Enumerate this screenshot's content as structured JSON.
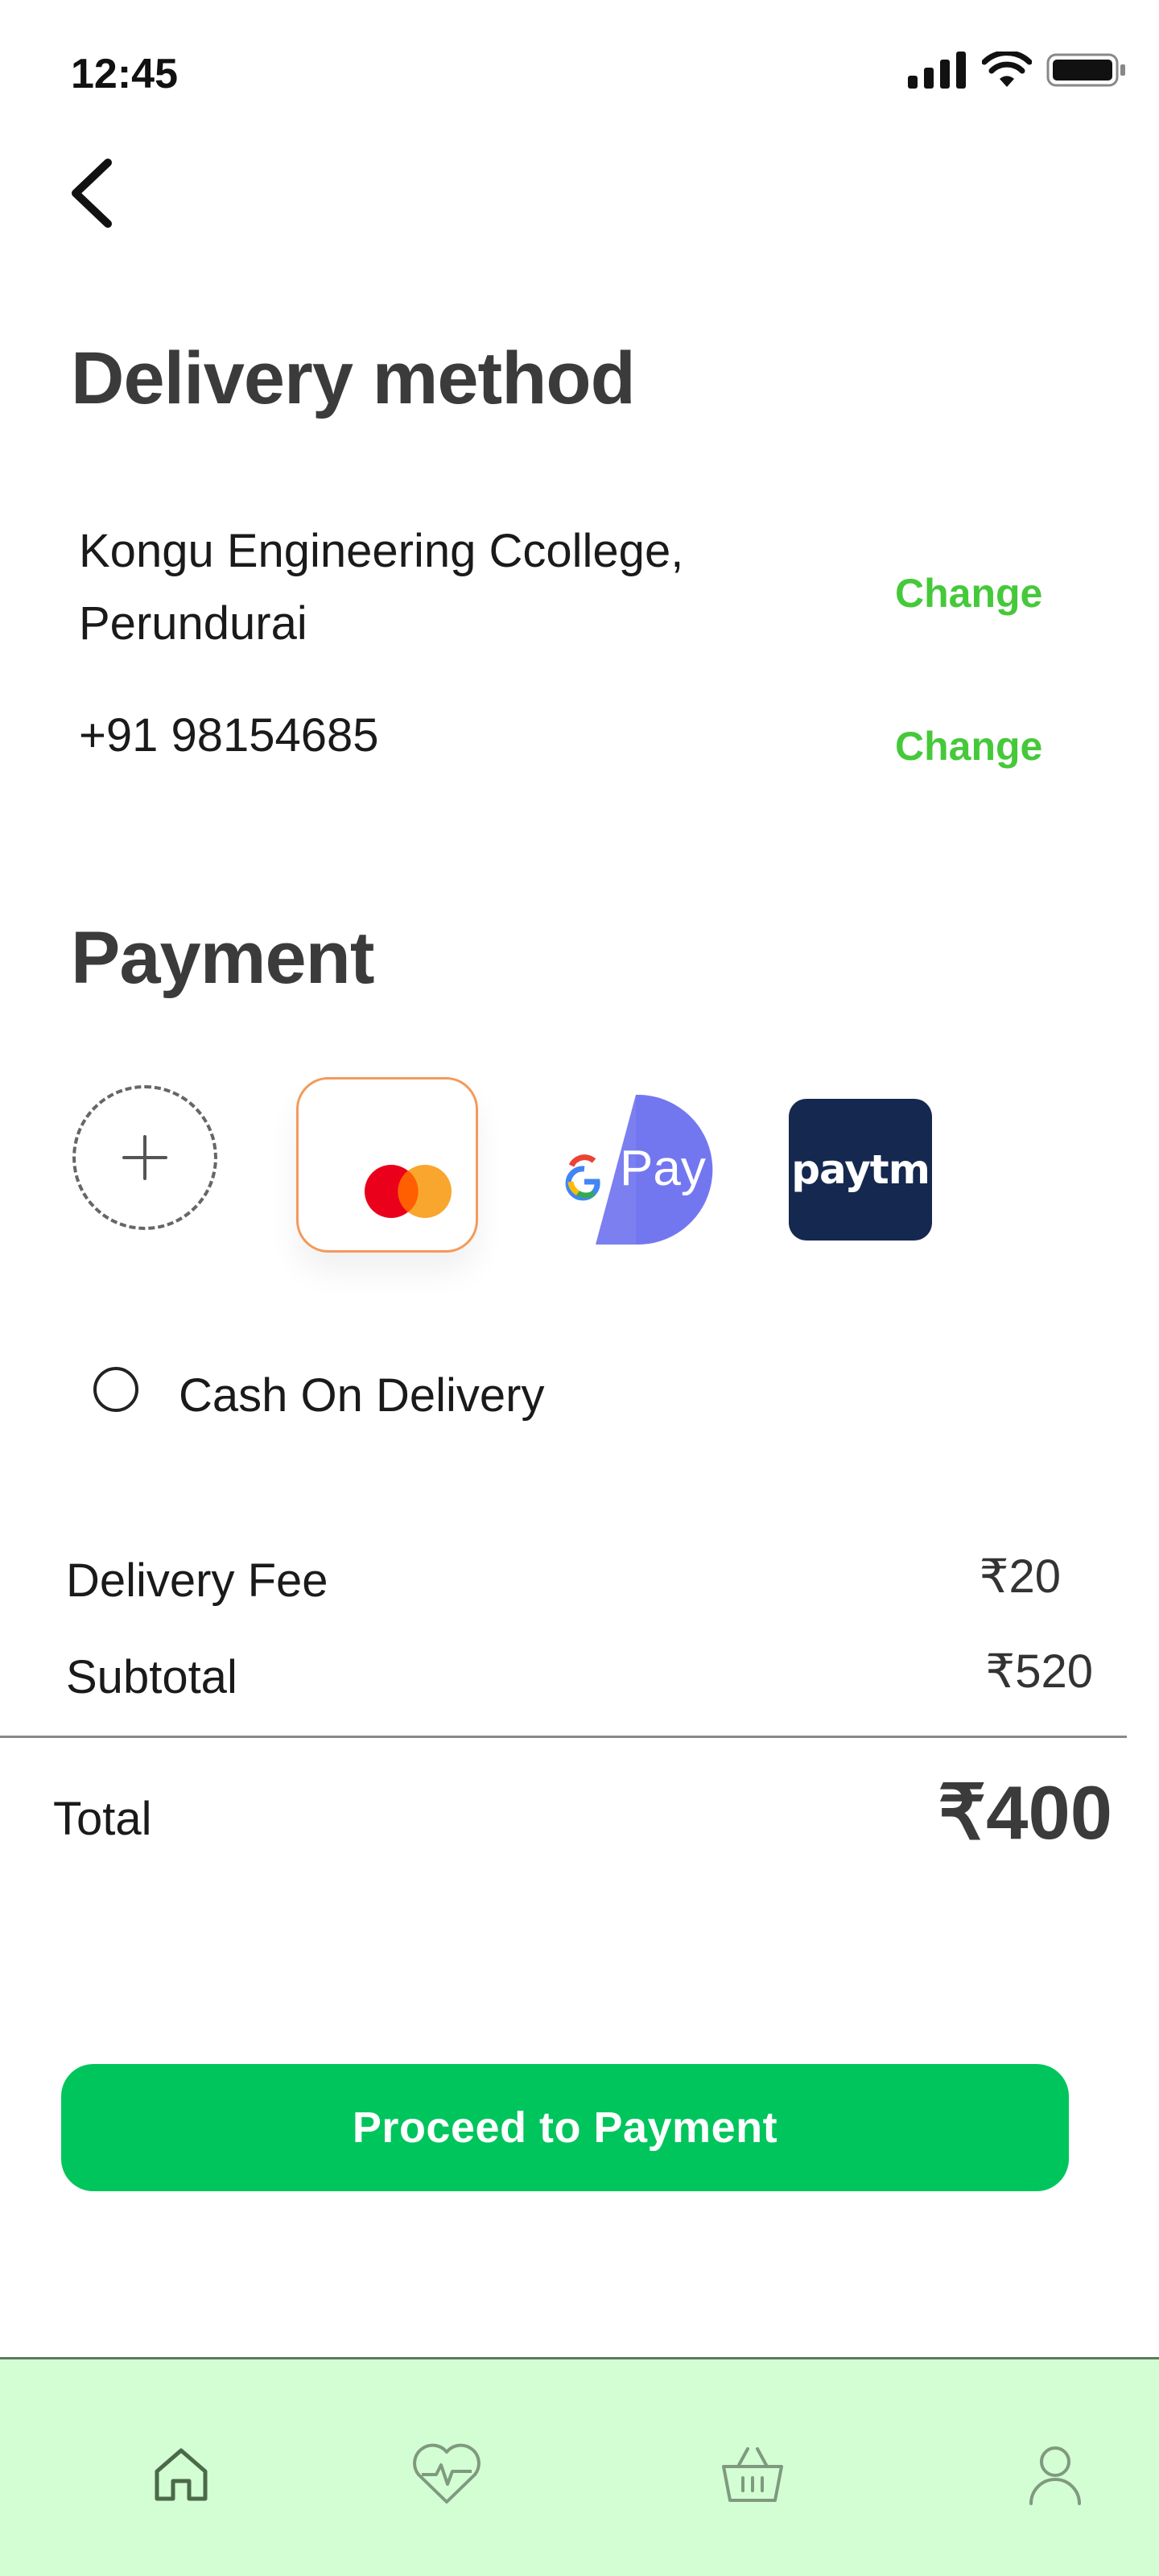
{
  "status_bar": {
    "time": "12:45",
    "icons": [
      "signal-icon",
      "wifi-icon",
      "battery-icon"
    ]
  },
  "header": {
    "back_icon": "chevron-left-icon"
  },
  "delivery": {
    "title": "Delivery method",
    "address_line1": "Kongu Engineering Ccollege,",
    "address_line2": "Perundurai",
    "phone": "+91 98154685",
    "change_address_label": "Change",
    "change_phone_label": "Change",
    "accent_color": "#45c93a"
  },
  "payment": {
    "title": "Payment",
    "methods": [
      {
        "icon": "add-icon"
      },
      {
        "icon": "mastercard-icon"
      },
      {
        "icon": "gpay-icon",
        "label": "Pay"
      },
      {
        "icon": "paytm-icon",
        "label": "paytm"
      }
    ],
    "cash_on_delivery_label": "Cash On Delivery"
  },
  "summary": {
    "delivery_fee_label": "Delivery Fee",
    "delivery_fee_value": "₹20",
    "subtotal_label": "Subtotal",
    "subtotal_value": "₹520",
    "total_label": "Total",
    "total_value": "₹400"
  },
  "cta": {
    "label": "Proceed to Payment",
    "color": "#00c55d"
  },
  "bottom_nav": {
    "background": "#d3fed3",
    "items": [
      "home-icon",
      "health-icon",
      "basket-icon",
      "profile-icon"
    ]
  }
}
